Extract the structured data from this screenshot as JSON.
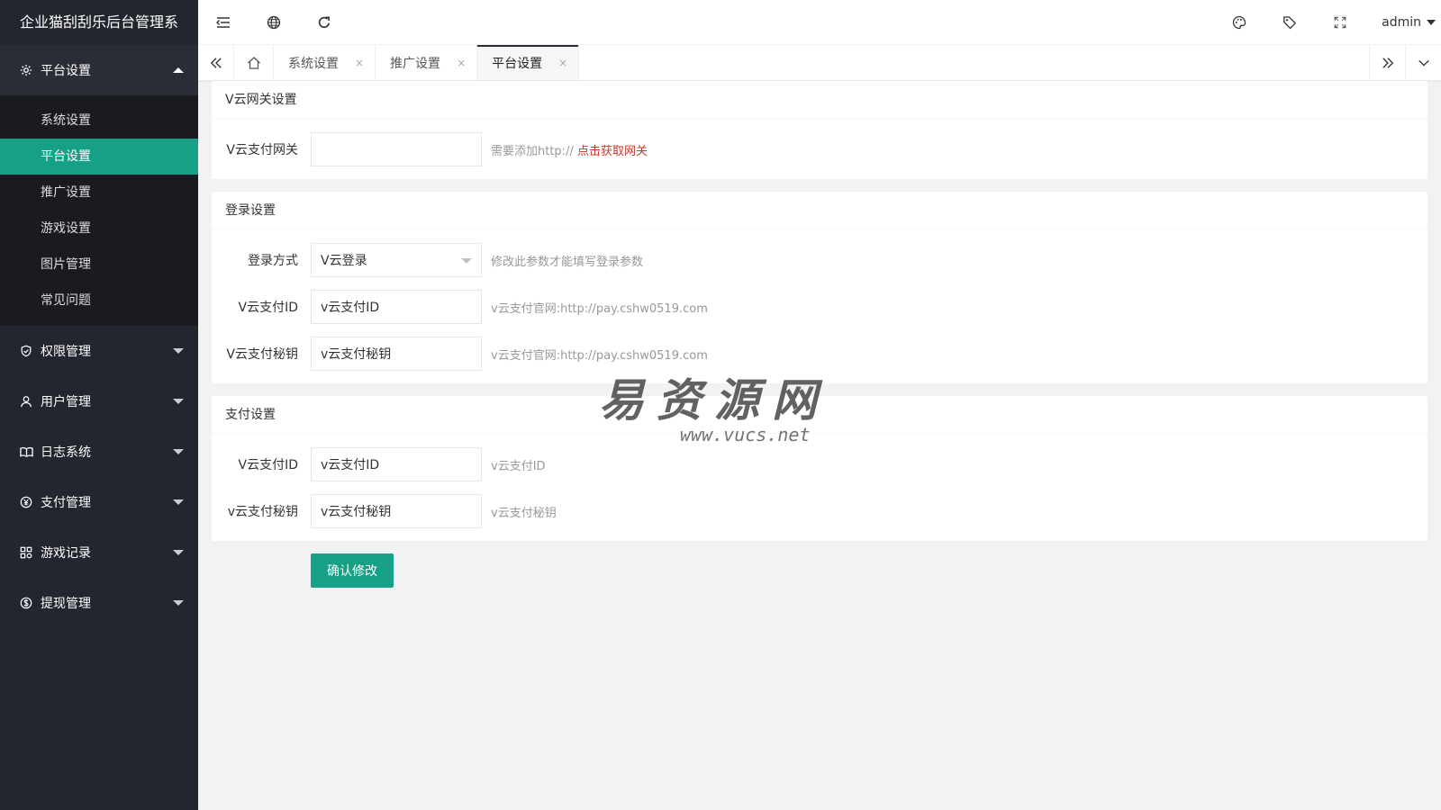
{
  "app": {
    "title": "企业猫刮刮乐后台管理系"
  },
  "sidebar": {
    "groups": [
      {
        "label": "平台设置",
        "icon": "gear-icon",
        "open": true,
        "items": [
          {
            "label": "系统设置"
          },
          {
            "label": "平台设置",
            "active": true
          },
          {
            "label": "推广设置"
          },
          {
            "label": "游戏设置"
          },
          {
            "label": "图片管理"
          },
          {
            "label": "常见问题"
          }
        ]
      },
      {
        "label": "权限管理",
        "icon": "shield-icon"
      },
      {
        "label": "用户管理",
        "icon": "user-icon"
      },
      {
        "label": "日志系统",
        "icon": "book-icon"
      },
      {
        "label": "支付管理",
        "icon": "yen-icon"
      },
      {
        "label": "游戏记录",
        "icon": "apps-icon"
      },
      {
        "label": "提现管理",
        "icon": "dollar-icon"
      }
    ]
  },
  "header": {
    "user": "admin"
  },
  "tabs": [
    {
      "label": "系统设置",
      "close": "×"
    },
    {
      "label": "推广设置",
      "close": "×"
    },
    {
      "label": "平台设置",
      "close": "×",
      "active": true
    }
  ],
  "sections": {
    "gateway": {
      "title": "V云网关设置",
      "field_label": "V云支付网关",
      "value": "",
      "hint": "需要添加http://",
      "hint_link": "点击获取网关"
    },
    "login": {
      "title": "登录设置",
      "method_label": "登录方式",
      "method_value": "V云登录",
      "method_hint": "修改此参数才能填写登录参数",
      "id_label": "V云支付ID",
      "id_value": "v云支付ID",
      "id_hint": "v云支付官网:http://pay.cshw0519.com",
      "key_label": "V云支付秘钥",
      "key_value": "v云支付秘钥",
      "key_hint": "v云支付官网:http://pay.cshw0519.com"
    },
    "payment": {
      "title": "支付设置",
      "id_label": "V云支付ID",
      "id_value": "v云支付ID",
      "id_hint": "v云支付ID",
      "key_label": "v云支付秘钥",
      "key_value": "v云支付秘钥",
      "key_hint": "v云支付秘钥"
    }
  },
  "submit_label": "确认修改",
  "watermark": {
    "text": "易资源网",
    "url": "www.vucs.net"
  },
  "colors": {
    "accent": "#16a085",
    "sidebar_bg": "#23262e",
    "subnav_bg": "#191b21",
    "link": "#c0392b"
  }
}
